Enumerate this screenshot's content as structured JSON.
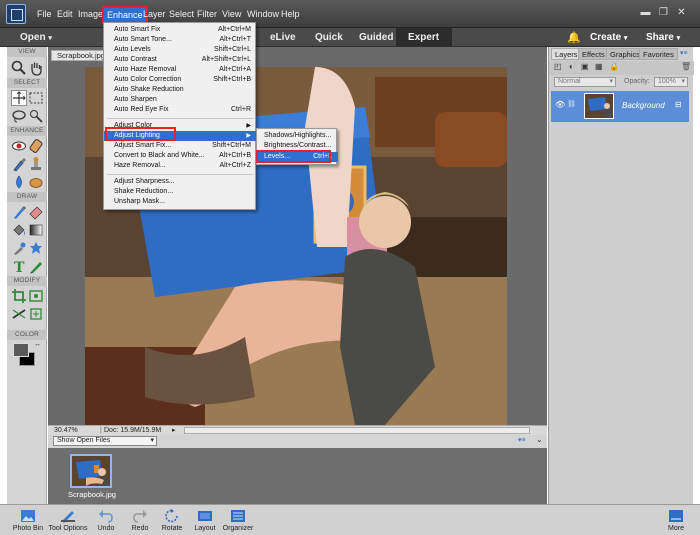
{
  "menubar": {
    "items": [
      "File",
      "Edit",
      "Image",
      "Enhance",
      "Layer",
      "Select",
      "Filter",
      "View",
      "Window",
      "Help"
    ],
    "active": "Enhance"
  },
  "modebar": {
    "open_label": "Open",
    "elive": "eLive",
    "quick": "Quick",
    "guided": "Guided",
    "expert": "Expert",
    "create": "Create",
    "share": "Share"
  },
  "toolbar": {
    "sections": [
      "VIEW",
      "SELECT",
      "ENHANCE",
      "DRAW",
      "MODIFY",
      "COLOR"
    ]
  },
  "document": {
    "tab_name": "Scrapbook.jpg",
    "zoom": "30.47%",
    "doc_size": "Doc: 15.9M/15.9M"
  },
  "bin": {
    "select_value": "Show Open Files",
    "thumb_label": "Scrapbook.jpg"
  },
  "panels": {
    "tabs": [
      "Layers",
      "Effects",
      "Graphics",
      "Favorites"
    ],
    "blend_mode": "Normal",
    "opacity_label": "Opacity:",
    "opacity_value": "100%",
    "layer_name": "Background"
  },
  "enhance_menu": {
    "group1": [
      {
        "label": "Auto Smart Fix",
        "shortcut": "Alt+Ctrl+M"
      },
      {
        "label": "Auto Smart Tone...",
        "shortcut": "Alt+Ctrl+T"
      },
      {
        "label": "Auto Levels",
        "shortcut": "Shift+Ctrl+L"
      },
      {
        "label": "Auto Contrast",
        "shortcut": "Alt+Shift+Ctrl+L"
      },
      {
        "label": "Auto Haze Removal",
        "shortcut": "Alt+Ctrl+A"
      },
      {
        "label": "Auto Color Correction",
        "shortcut": "Shift+Ctrl+B"
      },
      {
        "label": "Auto Shake Reduction",
        "shortcut": ""
      },
      {
        "label": "Auto Sharpen",
        "shortcut": ""
      },
      {
        "label": "Auto Red Eye Fix",
        "shortcut": "Ctrl+R"
      }
    ],
    "group2": [
      {
        "label": "Adjust Color",
        "shortcut": ""
      },
      {
        "label": "Adjust Lighting",
        "shortcut": ""
      },
      {
        "label": "Adjust Smart Fix...",
        "shortcut": "Shift+Ctrl+M"
      },
      {
        "label": "Convert to Black and White...",
        "shortcut": "Alt+Ctrl+B"
      },
      {
        "label": "Haze Removal...",
        "shortcut": "Alt+Ctrl+Z"
      }
    ],
    "group3": [
      {
        "label": "Adjust Sharpness...",
        "shortcut": ""
      },
      {
        "label": "Shake Reduction...",
        "shortcut": ""
      },
      {
        "label": "Unsharp Mask...",
        "shortcut": ""
      }
    ]
  },
  "lighting_submenu": [
    {
      "label": "Shadows/Highlights...",
      "shortcut": ""
    },
    {
      "label": "Brightness/Contrast...",
      "shortcut": ""
    },
    {
      "label": "Levels...",
      "shortcut": "Ctrl+L"
    }
  ],
  "bottombar": {
    "items": [
      "Photo Bin",
      "Tool Options",
      "Undo",
      "Redo",
      "Rotate",
      "Layout",
      "Organizer"
    ],
    "more": "More"
  }
}
